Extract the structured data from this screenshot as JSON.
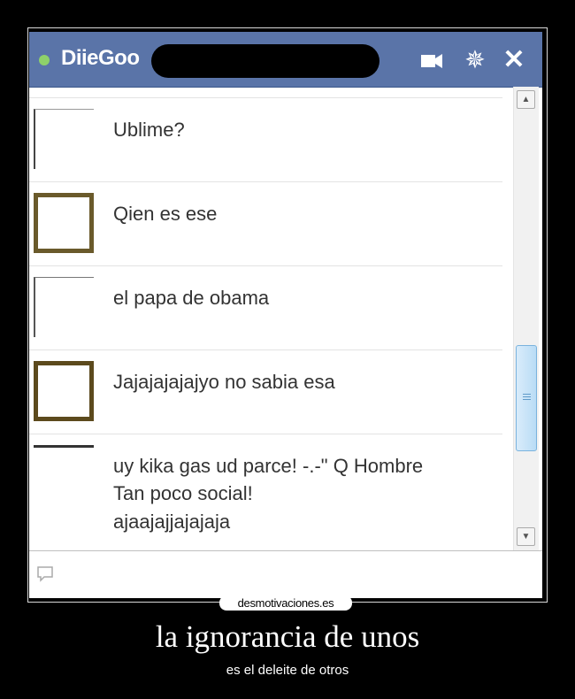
{
  "chat": {
    "name": "DiieGoo",
    "status_color": "#8ed16a",
    "header_color": "#5a74a8",
    "icons": {
      "video": "video-camera-icon",
      "settings": "gear-icon",
      "close": "close-icon"
    },
    "messages": [
      {
        "text": "Ublime?"
      },
      {
        "text": "Qien es ese"
      },
      {
        "text": "el papa de obama"
      },
      {
        "text": "Jajajajajajyo no sabia esa"
      },
      {
        "text": "uy kika gas ud parce! -.-\" Q Hombre\nTan  poco social!",
        "text2": "ajaajajjajajaja"
      }
    ],
    "input_icon": "speech-bubble-icon"
  },
  "watermark": "desmotivaciones.es",
  "caption": {
    "title": "la ignorancia de unos",
    "subtitle": "es el deleite de otros"
  }
}
